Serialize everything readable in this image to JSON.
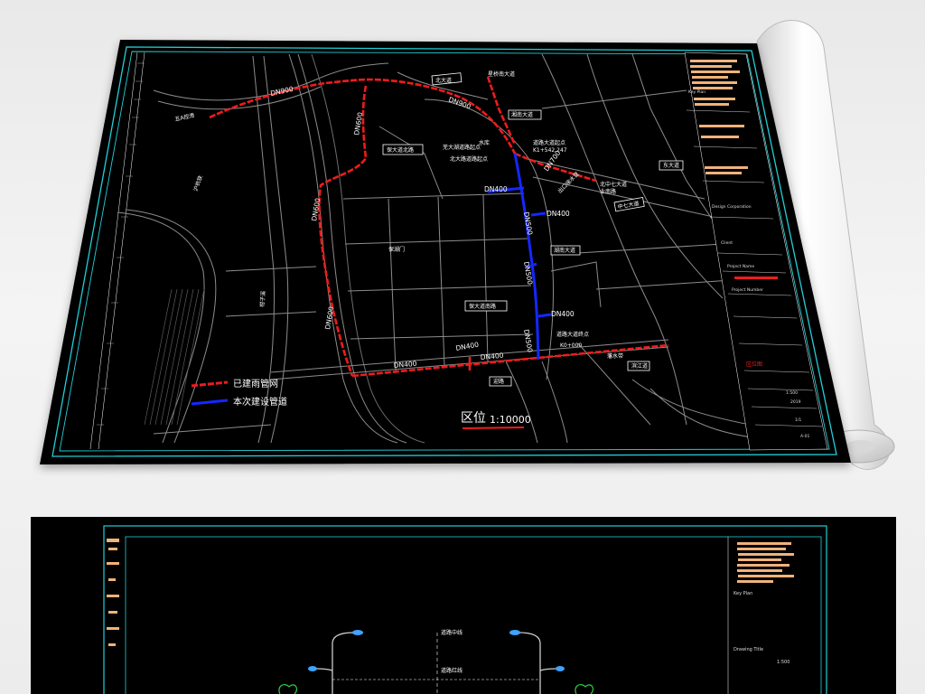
{
  "map": {
    "road_labels": {
      "north_ave": "北大道",
      "wuyi_north_1": "五A控滑",
      "line_top": "星桥南大道",
      "xianrong_ave": "湘南大道",
      "baoda_north": "保大道北路",
      "water_plant": "水库",
      "branch_note": "芜大湖道路起点",
      "junction_note": "北大路道路起点",
      "station_k1": "道路大道起点",
      "station_k1_value": "K1+542.247",
      "east_ave_1": "东大道",
      "middle_ave": "中七大道",
      "middle_label_a": "北中七大道",
      "middle_label_b": "业南路",
      "middle_label_c": "出口接水管",
      "south_label": "湖南大道",
      "baoda_south": "保大道南路",
      "river_road": "滨江道",
      "start_label": "道路大道终点",
      "start_value": "K0+000",
      "creek_road": "藩水带",
      "bottom_road": "迎路",
      "west_rail": "沪杭铁",
      "west_road": "柑子溪",
      "mid_west": "保湖门"
    },
    "pipe_labels": {
      "dn900": "DN900",
      "dn900_b": "DN900",
      "dn600_a": "DN600",
      "dn600_b": "DN600",
      "dn600_c": "DN600",
      "dn700": "DN700",
      "dn500_a": "DN500",
      "dn500_b": "DN500",
      "dn500_c": "DN500",
      "dn400_a": "DN400",
      "dn400_b": "DN400",
      "dn400_c": "DN400",
      "dn400_d": "DN400",
      "dn400_e": "DN400",
      "dn400_f": "DN400"
    },
    "legend": {
      "existing": "已建雨管网",
      "current": "本次建设管道"
    },
    "scale": {
      "title": "区位",
      "ratio": "1:10000"
    },
    "colors": {
      "existing_pipe": "#ee1c1c",
      "current_pipe": "#1428ff",
      "frame": "#22cfd6",
      "roads": "#8c8c8c",
      "title_block_fill": "#f0b27a"
    },
    "title_block": {
      "line_1": "Key Plan",
      "line_2": "Design Corporation",
      "line_3": "Client",
      "line_4": "Project Name",
      "line_5": "Project Number",
      "drawing_title": "区位图",
      "drawing_no": "A-01",
      "scale_value": "1:500",
      "date": "2019",
      "sheet": "1/1"
    }
  },
  "second": {
    "title_block": {
      "key_plan": "Key Plan",
      "drawing_title": "Drawing Title",
      "scale": "1:500"
    },
    "section_labels": {
      "road_center": "道路中线",
      "road_red": "道路红线"
    }
  }
}
